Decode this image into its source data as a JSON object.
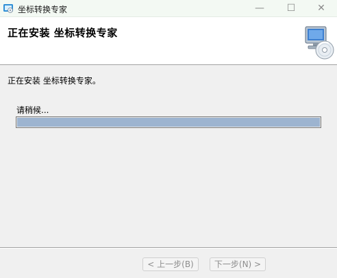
{
  "window": {
    "title": "坐标转换专家",
    "minimize_glyph": "—",
    "maximize_glyph": "☐",
    "close_glyph": "✕",
    "app_icon": "installer-icon"
  },
  "header": {
    "title": "正在安装 坐标转换专家",
    "graphic": "computer-cd-icon"
  },
  "main": {
    "status": "正在安装 坐标转换专家。",
    "wait_label": "请稍候...",
    "progress_fraction": 1.0
  },
  "footer": {
    "back_label": "< 上一步(B)",
    "next_label": "下一步(N) >"
  },
  "colors": {
    "titlebar": "#f3f9f3",
    "header_bg": "#ffffff",
    "body_bg": "#f0f0f0",
    "progress_fill": "#9db4d0"
  }
}
